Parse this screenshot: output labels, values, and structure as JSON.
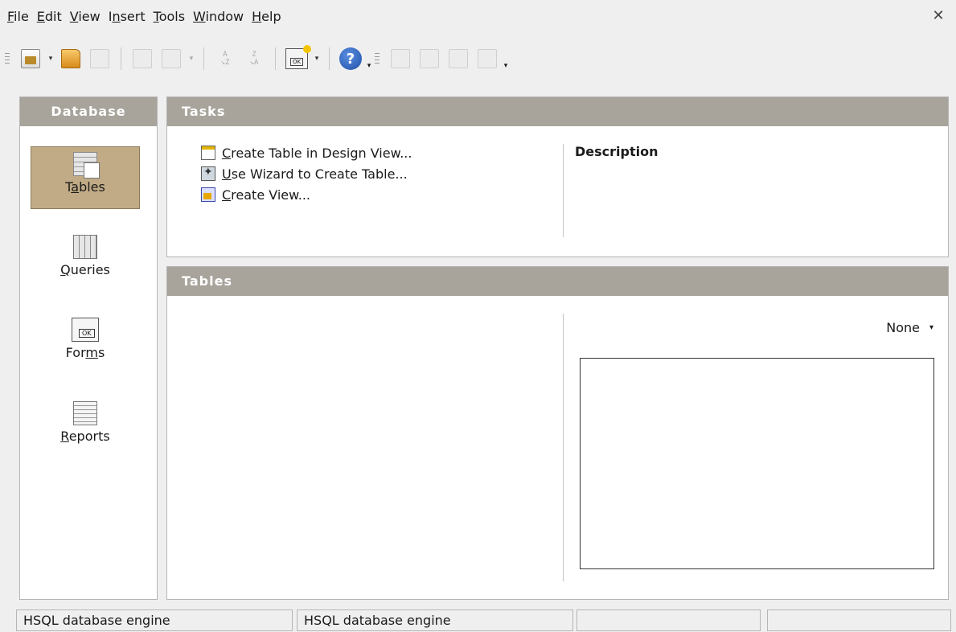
{
  "menubar": {
    "items": [
      {
        "accel": "F",
        "rest": "ile"
      },
      {
        "accel": "E",
        "rest": "dit"
      },
      {
        "accel": "V",
        "rest": "iew"
      },
      {
        "pre": "I",
        "accel": "n",
        "rest": "sert"
      },
      {
        "accel": "T",
        "rest": "ools"
      },
      {
        "accel": "W",
        "rest": "indow"
      },
      {
        "accel": "H",
        "rest": "elp"
      }
    ],
    "close_glyph": "✕"
  },
  "toolbar": {
    "icons": [
      "new-document-icon",
      "open-folder-icon",
      "save-icon",
      "copy-icon",
      "paste-icon",
      "sort-ascending-icon",
      "sort-descending-icon",
      "form-design-icon",
      "help-icon",
      "table-icon",
      "edit-icon",
      "delete-icon",
      "rename-icon"
    ],
    "sort_asc_top": "A",
    "sort_asc_bottom": "↘Z",
    "sort_desc_top": "Z",
    "sort_desc_bottom": "↘A",
    "help_glyph": "?",
    "dropdown_glyph": "▾"
  },
  "database_panel": {
    "header": "Database",
    "categories": [
      {
        "pre": "T",
        "accel": "a",
        "rest": "bles",
        "selected": true
      },
      {
        "pre": "",
        "accel": "Q",
        "rest": "ueries",
        "selected": false
      },
      {
        "pre": "For",
        "accel": "m",
        "rest": "s",
        "selected": false
      },
      {
        "pre": "",
        "accel": "R",
        "rest": "eports",
        "selected": false
      }
    ]
  },
  "tasks_panel": {
    "header": "Tasks",
    "tasks": [
      {
        "accel": "C",
        "rest": "reate Table in Design View..."
      },
      {
        "accel": "U",
        "rest": "se Wizard to Create Table..."
      },
      {
        "accel": "C",
        "rest": "reate View..."
      }
    ],
    "description_title": "Description"
  },
  "tables_panel": {
    "header": "Tables",
    "preview_mode": "None",
    "dropdown_glyph": "▾"
  },
  "statusbar": {
    "cells": [
      "HSQL database engine",
      "HSQL database engine",
      "",
      ""
    ]
  },
  "colors": {
    "panel_header": "#a8a49c",
    "selected_category": "#c0ab86",
    "window_bg": "#efefef"
  }
}
